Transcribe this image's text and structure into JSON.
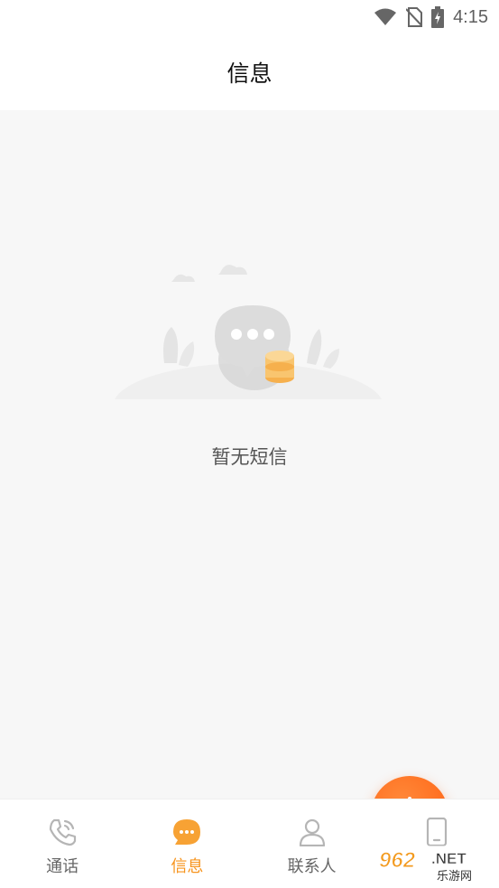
{
  "status_bar": {
    "time": "4:15",
    "icons": [
      "wifi-icon",
      "no-sim-icon",
      "battery-charging-icon"
    ]
  },
  "header": {
    "title": "信息"
  },
  "main": {
    "empty_state": {
      "icon": "chat-bubble-empty-illustration",
      "text": "暂无短信"
    },
    "fab": {
      "icon": "plus-icon",
      "color": "#ff6a1a"
    }
  },
  "bottom_nav": {
    "active_color": "#f7941d",
    "items": [
      {
        "label": "通话",
        "icon": "phone-icon",
        "active": false
      },
      {
        "label": "信息",
        "icon": "message-icon",
        "active": true
      },
      {
        "label": "联系人",
        "icon": "contact-icon",
        "active": false
      },
      {
        "label": "",
        "icon": "device-icon",
        "active": false
      }
    ]
  },
  "watermark": {
    "brand": "962",
    "suffix": ".NET",
    "sub": "乐游网"
  }
}
